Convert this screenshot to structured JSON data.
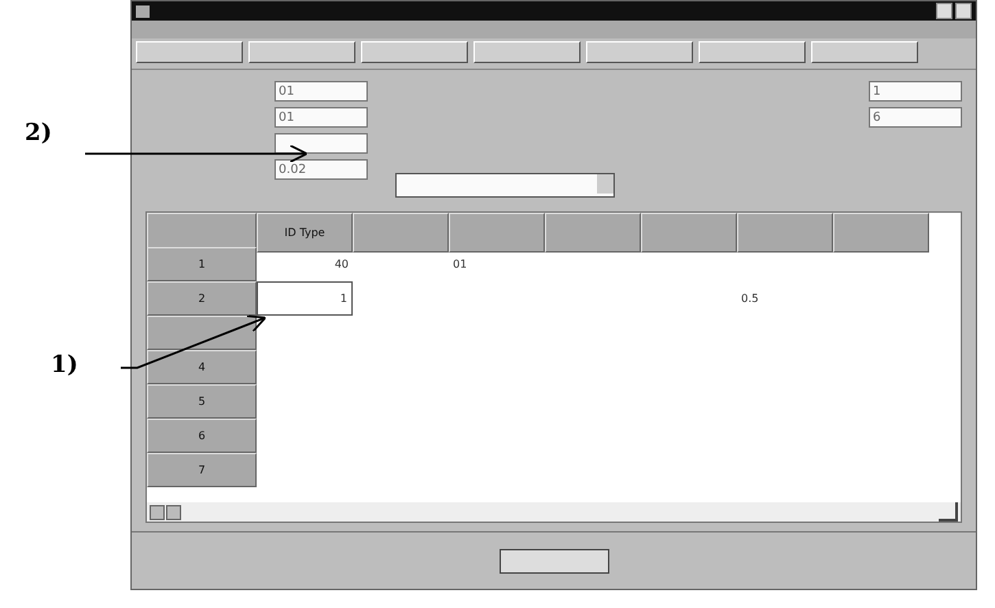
{
  "tool_buttons": [
    {
      "selected": false
    },
    {
      "selected": false
    },
    {
      "selected": false
    },
    {
      "selected": false
    },
    {
      "selected": false
    },
    {
      "selected": false
    },
    {
      "selected": false
    }
  ],
  "left_fields": [
    {
      "kind": "filled",
      "value": "01"
    },
    {
      "kind": "filled",
      "value": "01"
    },
    {
      "kind": "blank"
    },
    {
      "kind": "filled",
      "value": "0.02"
    }
  ],
  "right_fields": [
    {
      "kind": "filled",
      "value": "1"
    },
    {
      "kind": "filled",
      "value": "6"
    }
  ],
  "table": {
    "column_headers": [
      {
        "kind": "corner"
      },
      {
        "kind": "labeled",
        "label": "ID Type"
      },
      {
        "kind": "blank"
      },
      {
        "kind": "blank"
      },
      {
        "kind": "blank"
      },
      {
        "kind": "blank"
      },
      {
        "kind": "blank"
      },
      {
        "kind": "blank"
      }
    ],
    "rows": [
      {
        "header": "1",
        "cells": [
          "40",
          null,
          "01",
          null,
          null,
          null,
          null
        ]
      },
      {
        "header": "2",
        "cells": [
          "1",
          null,
          null,
          null,
          null,
          "0.5",
          null
        ],
        "editing": true
      },
      {
        "cells": [
          null,
          null,
          null,
          null,
          null,
          null,
          null
        ]
      },
      {
        "header": "4",
        "cells": [
          null,
          null,
          null,
          null,
          null,
          null,
          null
        ]
      },
      {
        "header": "5",
        "cells": [
          null,
          null,
          null,
          null,
          null,
          null,
          null
        ]
      },
      {
        "header": "6",
        "cells": [
          null,
          null,
          null,
          null,
          null,
          null,
          null
        ]
      },
      {
        "header": "7",
        "cells": [
          null,
          null,
          null,
          null,
          null,
          null,
          null
        ]
      }
    ]
  },
  "annotations": [
    {
      "label": "2)"
    },
    {
      "label": "1)"
    }
  ]
}
